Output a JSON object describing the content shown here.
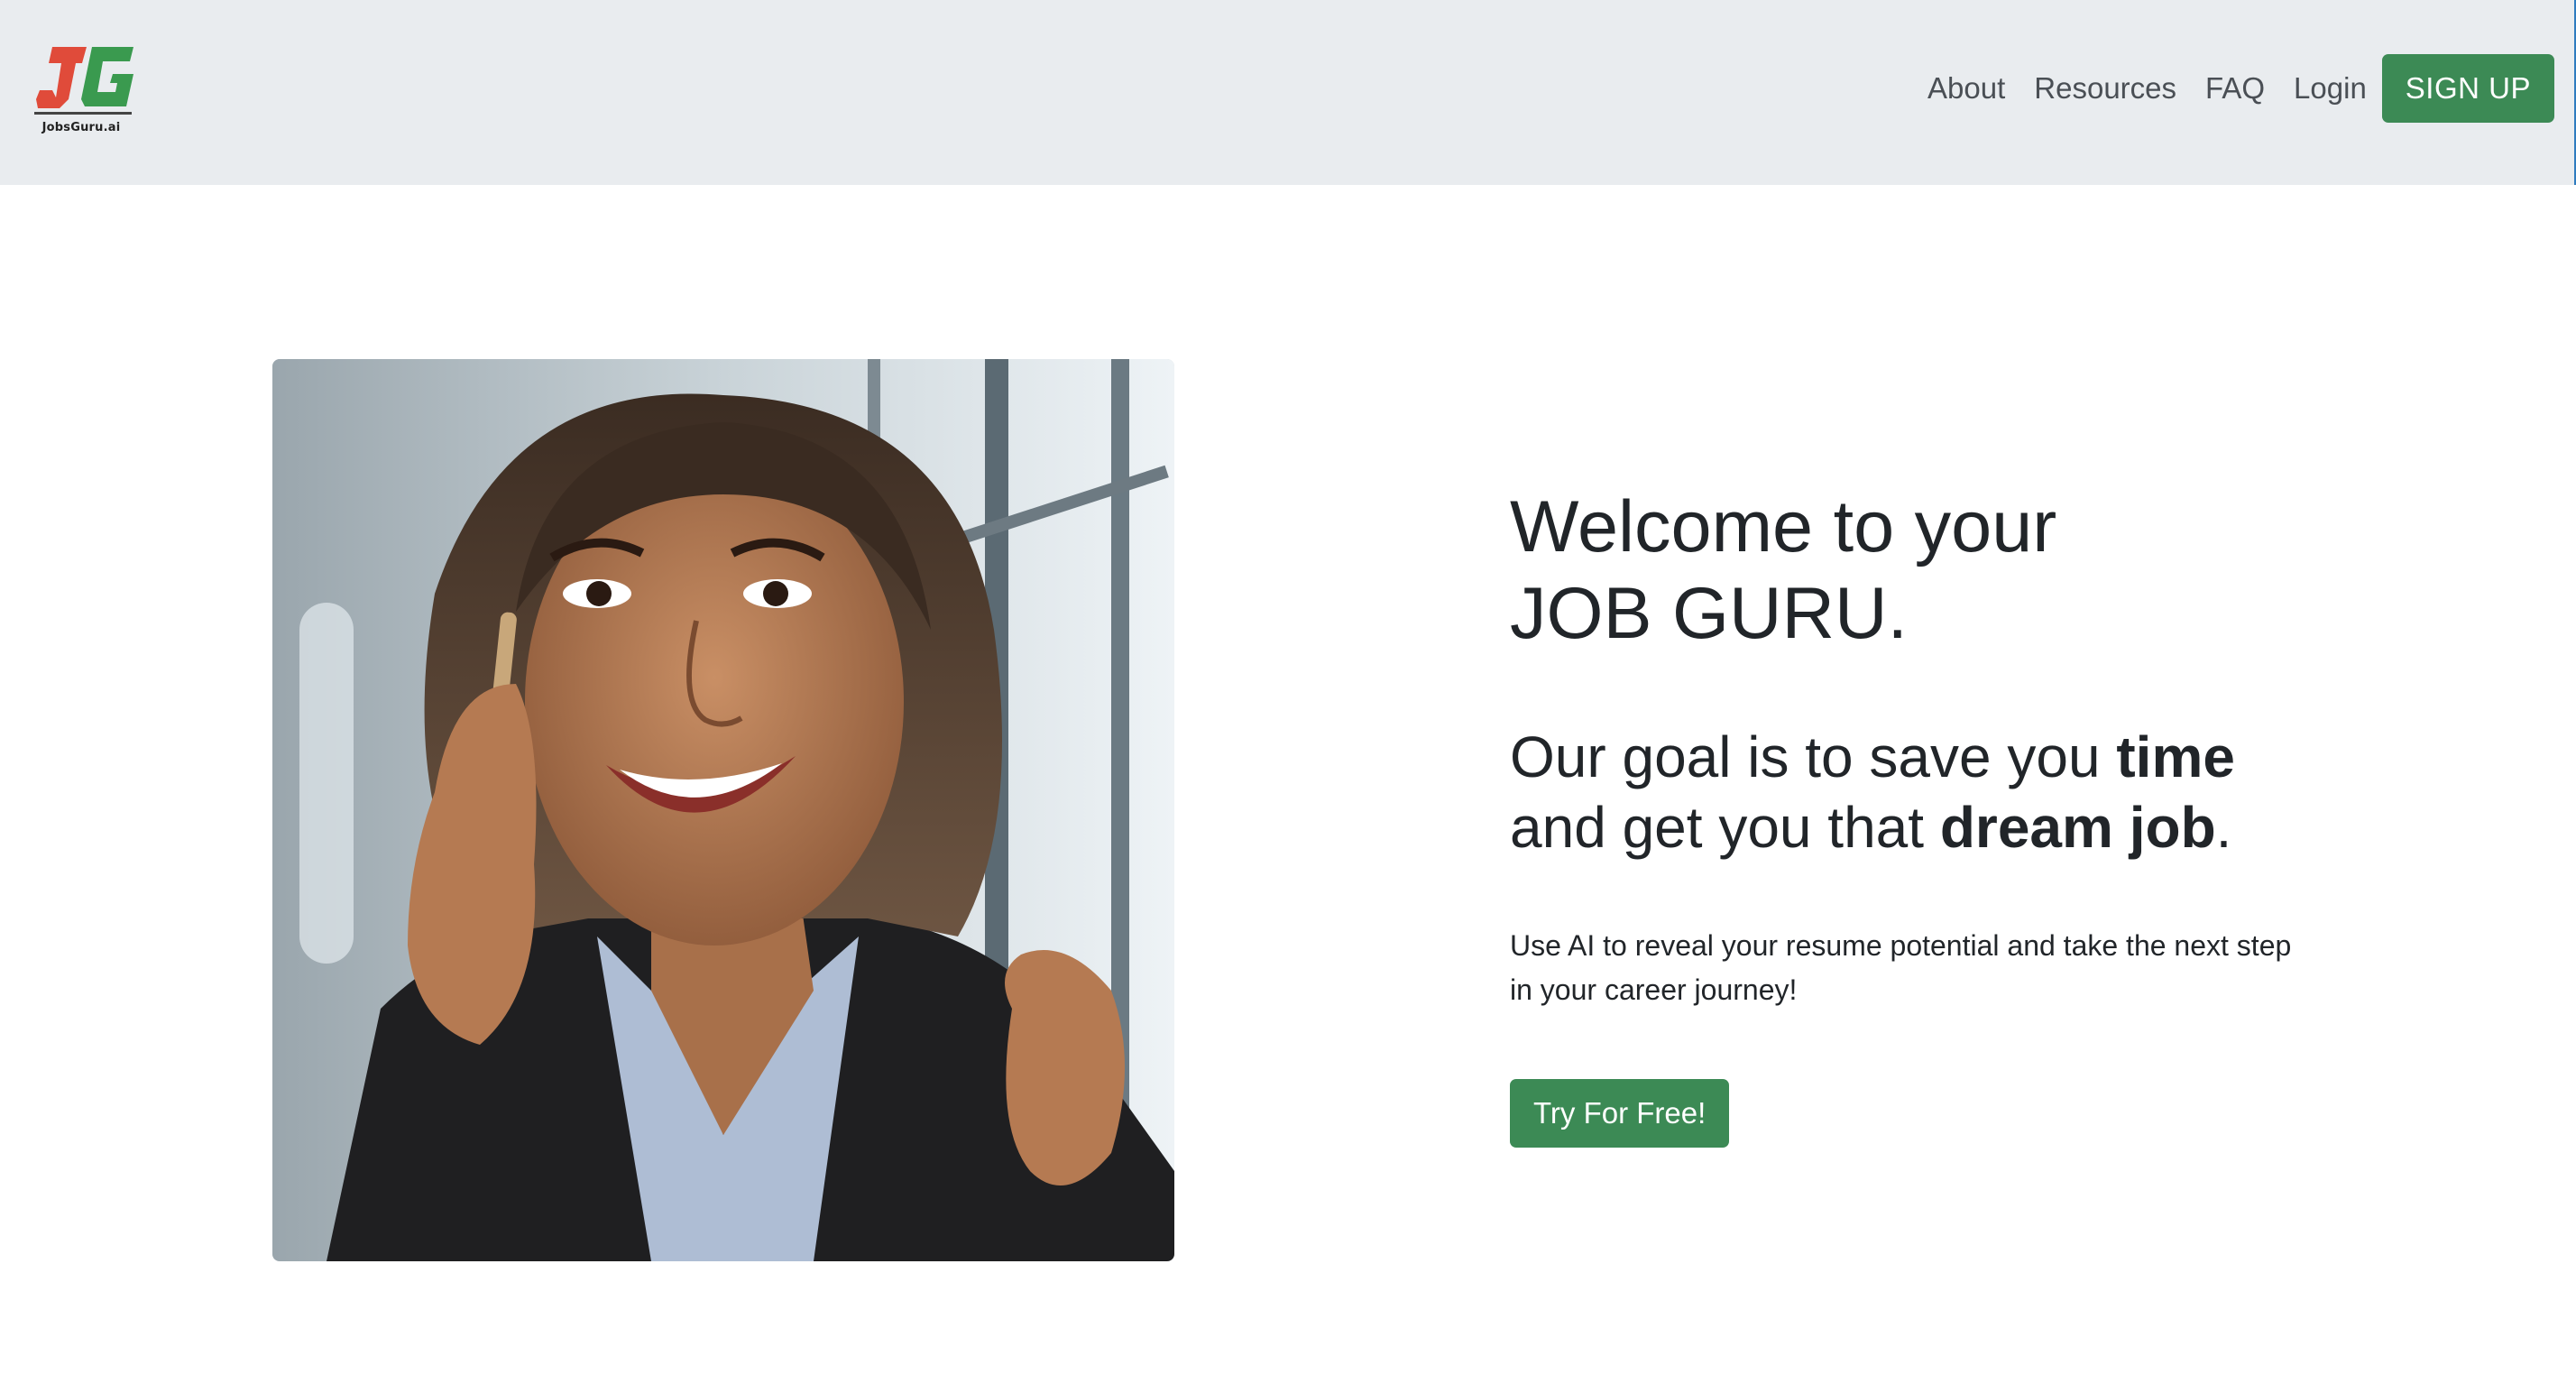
{
  "brand": {
    "name": "JobsGuru.ai",
    "logo_letters": "JG",
    "colors": {
      "j": "#e04b3a",
      "g": "#3a9a4f"
    }
  },
  "nav": {
    "links": [
      "About",
      "Resources",
      "FAQ",
      "Login"
    ],
    "signup_label": "SIGN UP"
  },
  "hero": {
    "image_description": "smiling-woman-on-phone",
    "heading_line1": "Welcome to your",
    "heading_line2": "JOB GURU.",
    "goal_part1": "Our goal is to save you ",
    "goal_bold1": "time",
    "goal_part2": "and get you that ",
    "goal_bold2": "dream job",
    "goal_end": ".",
    "description": "Use AI to reveal your resume potential and take the next step in your career journey!",
    "cta_label": "Try For Free!"
  },
  "colors": {
    "navbar_bg": "#e9ecef",
    "accent_green": "#3c8a55",
    "text_dark": "#212529"
  }
}
